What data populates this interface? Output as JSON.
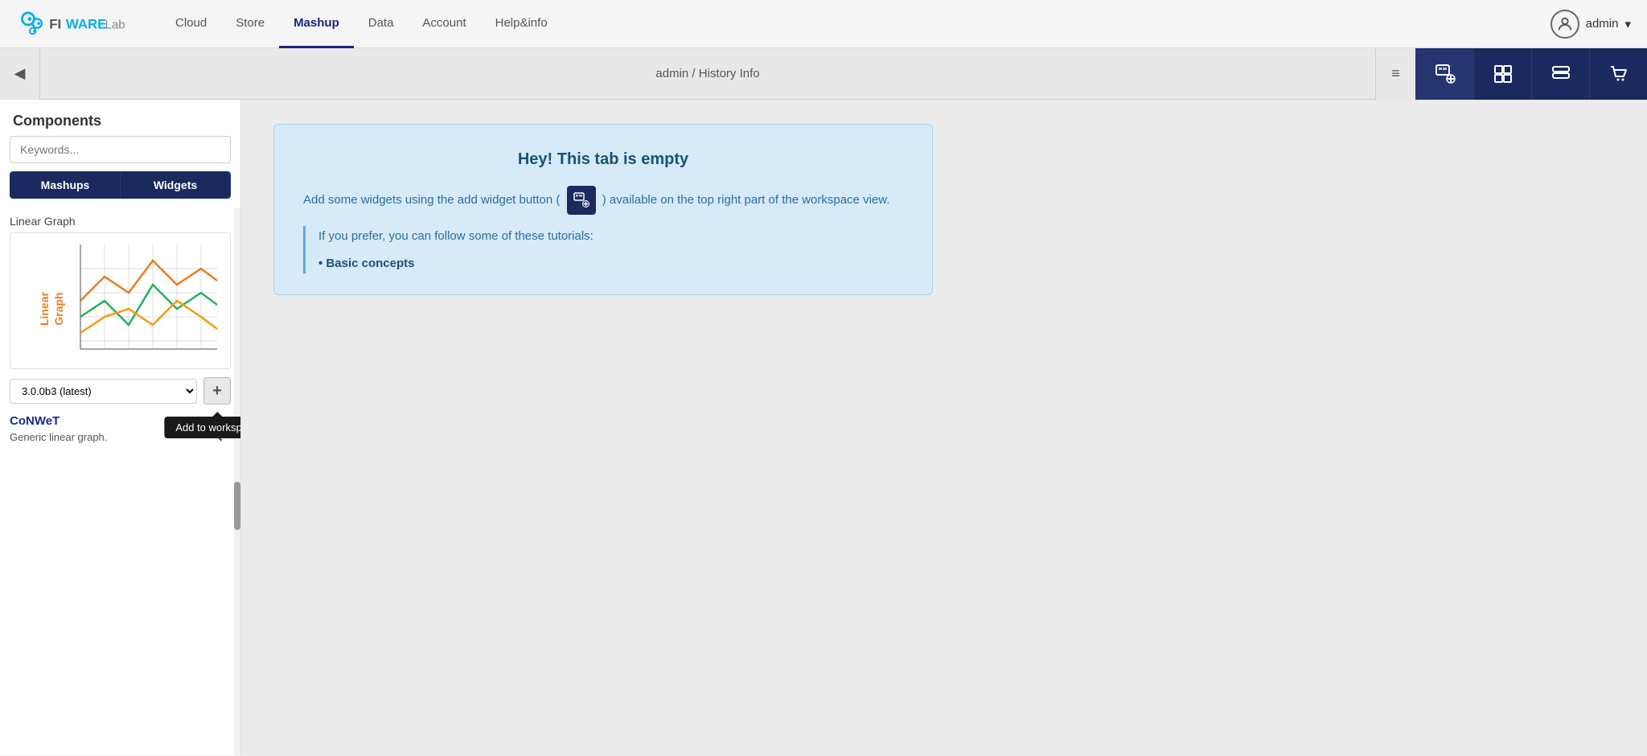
{
  "nav": {
    "logo_text": "FIWARELab",
    "items": [
      {
        "id": "cloud",
        "label": "Cloud",
        "active": false
      },
      {
        "id": "store",
        "label": "Store",
        "active": false
      },
      {
        "id": "mashup",
        "label": "Mashup",
        "active": true
      },
      {
        "id": "data",
        "label": "Data",
        "active": false
      },
      {
        "id": "account",
        "label": "Account",
        "active": false
      },
      {
        "id": "helpinfo",
        "label": "Help&info",
        "active": false
      }
    ],
    "user_label": "admin",
    "user_dropdown_icon": "▾"
  },
  "toolbar": {
    "collapse_icon": "◀",
    "breadcrumb": "admin / History Info",
    "menu_icon": "≡",
    "actions": [
      {
        "id": "add-widget",
        "icon": "widget-add"
      },
      {
        "id": "add-component",
        "icon": "puzzle"
      },
      {
        "id": "add-workspace",
        "icon": "storage"
      },
      {
        "id": "cart",
        "icon": "cart"
      }
    ]
  },
  "sidebar": {
    "title": "Components",
    "search_placeholder": "Keywords...",
    "tab_mashups": "Mashups",
    "tab_widgets": "Widgets",
    "component": {
      "name": "Linear Graph",
      "version": "3.0.0b3 (latest)",
      "author": "CoNWeT",
      "description": "Generic linear graph."
    },
    "add_label": "+",
    "tooltip_label": "Add to workspace"
  },
  "main": {
    "empty_title": "Hey! This tab is empty",
    "empty_body1": "Add some widgets using the add widget button (",
    "empty_body2": ") available on the top right part of the workspace view.",
    "tutorials_intro": "If you prefer, you can follow some of these tutorials:",
    "tutorials": [
      {
        "label": "Basic concepts",
        "url": "#"
      }
    ]
  }
}
